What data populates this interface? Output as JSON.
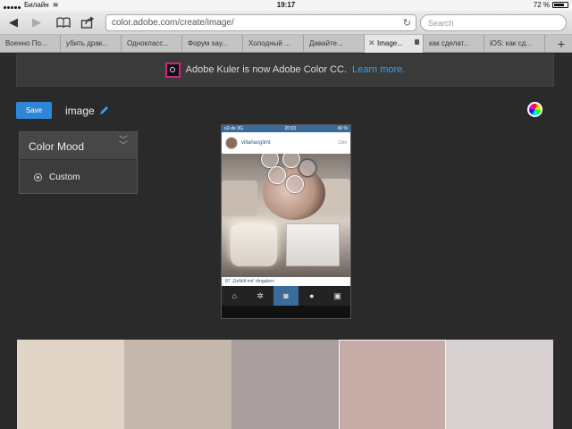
{
  "status": {
    "carrier": "Билайн",
    "time": "19:17",
    "battery": "72 %"
  },
  "browser": {
    "url": "color.adobe.com/create/image/",
    "search_placeholder": "Search",
    "tabs": [
      {
        "label": "Военно По..."
      },
      {
        "label": "убить драк..."
      },
      {
        "label": "Однокласс..."
      },
      {
        "label": "Форум say..."
      },
      {
        "label": "Холодный ..."
      },
      {
        "label": "Давайте..."
      },
      {
        "label": "Image...",
        "active": true
      },
      {
        "label": "как сделат..."
      },
      {
        "label": "iOS: как сд..."
      }
    ]
  },
  "banner": {
    "text": "Adobe Kuler is now Adobe Color CC.",
    "link": "Learn more."
  },
  "editor": {
    "save_label": "Save",
    "theme_name": "image"
  },
  "mood": {
    "title": "Color Mood",
    "option": "Custom"
  },
  "photo": {
    "status_carrier": "o2-de",
    "status_network": "3G",
    "status_time": "20:03",
    "status_battery": "40 %",
    "username": "villahavglimt",
    "time": "19m",
    "likes": "87 „Gefällt mir“-Angaben"
  },
  "swatches": [
    {
      "color": "#e1d5c8"
    },
    {
      "color": "#c4b8ad"
    },
    {
      "color": "#ab9e9f"
    },
    {
      "color": "#c7aba6",
      "active": true
    },
    {
      "color": "#d8d1d1"
    }
  ]
}
